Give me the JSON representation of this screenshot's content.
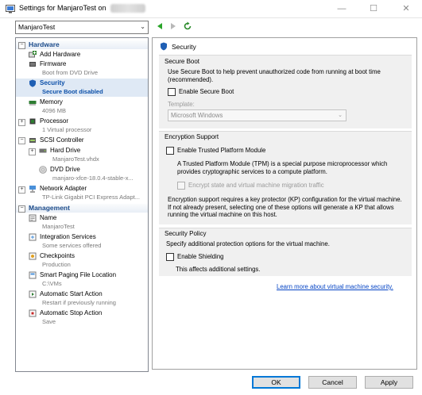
{
  "window": {
    "title": "Settings for ManjaroTest on",
    "minimize": "—",
    "maximize": "☐",
    "close": "✕"
  },
  "toolbar": {
    "vm_selected": "ManjaroTest"
  },
  "tree": {
    "hardware_label": "Hardware",
    "management_label": "Management",
    "hardware_items": [
      {
        "title": "Add Hardware",
        "sub": ""
      },
      {
        "title": "Firmware",
        "sub": "Boot from DVD Drive"
      },
      {
        "title": "Security",
        "sub": "Secure Boot disabled"
      },
      {
        "title": "Memory",
        "sub": "4096 MB"
      },
      {
        "title": "Processor",
        "sub": "1 Virtual processor"
      },
      {
        "title": "SCSI Controller",
        "sub": ""
      },
      {
        "title": "Hard Drive",
        "sub": "ManjaroTest.vhdx"
      },
      {
        "title": "DVD Drive",
        "sub": "manjaro-xfce-18.0.4-stable-x..."
      },
      {
        "title": "Network Adapter",
        "sub": "TP-Link Gigabit PCI Express Adapt..."
      }
    ],
    "management_items": [
      {
        "title": "Name",
        "sub": "ManjaroTest"
      },
      {
        "title": "Integration Services",
        "sub": "Some services offered"
      },
      {
        "title": "Checkpoints",
        "sub": "Production"
      },
      {
        "title": "Smart Paging File Location",
        "sub": "C:\\VMs"
      },
      {
        "title": "Automatic Start Action",
        "sub": "Restart if previously running"
      },
      {
        "title": "Automatic Stop Action",
        "sub": "Save"
      }
    ]
  },
  "security": {
    "heading": "Security",
    "secure_boot": {
      "title": "Secure Boot",
      "desc": "Use Secure Boot to help prevent unauthorized code from running at boot time (recommended).",
      "enable_label": "Enable Secure Boot",
      "enabled": false,
      "template_label": "Template:",
      "template_value": "Microsoft Windows"
    },
    "encryption": {
      "title": "Encryption Support",
      "tpm_label": "Enable Trusted Platform Module",
      "tpm_desc": "A Trusted Platform Module (TPM) is a special purpose microprocessor which provides cryptographic services to a compute platform.",
      "encrypt_label": "Encrypt state and virtual machine migration traffic",
      "note": "Encryption support requires a key protector (KP) configuration for the virtual machine. If not already present, selecting one of these options will generate a KP that allows running the virtual machine on this host."
    },
    "policy": {
      "title": "Security Policy",
      "desc": "Specify additional protection options for the virtual machine.",
      "shielding_label": "Enable Shielding",
      "shielding_desc": "This affects additional settings."
    },
    "learn_more": "Learn more about virtual machine security."
  },
  "buttons": {
    "ok": "OK",
    "cancel": "Cancel",
    "apply": "Apply"
  },
  "colors": {
    "accent": "#0078d7",
    "selected_text": "#0b4fa8",
    "section_text": "#1a4a8a",
    "link": "#0645c5"
  }
}
